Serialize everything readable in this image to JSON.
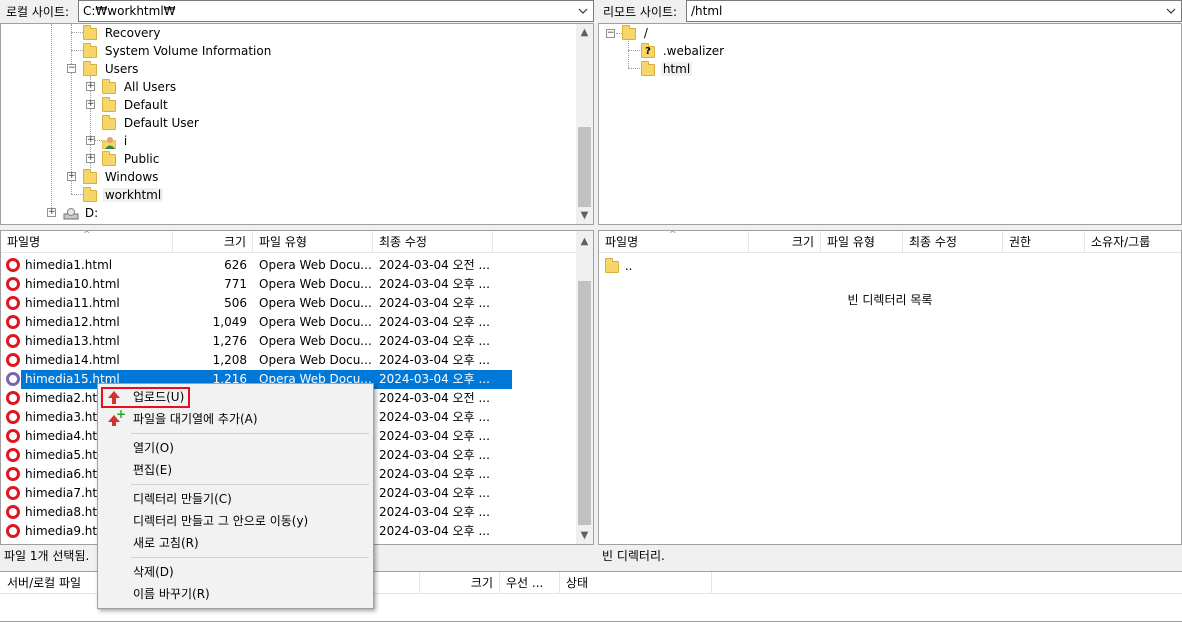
{
  "local_site": {
    "label": "로컬 사이트:",
    "path": "C:₩workhtml₩"
  },
  "remote_site": {
    "label": "리모트 사이트:",
    "path": "/html"
  },
  "local_tree": [
    {
      "label": "Recovery"
    },
    {
      "label": "System Volume Information"
    },
    {
      "label": "Users"
    },
    {
      "label": "All Users"
    },
    {
      "label": "Default"
    },
    {
      "label": "Default User"
    },
    {
      "label": "i"
    },
    {
      "label": "Public"
    },
    {
      "label": "Windows"
    },
    {
      "label": "workhtml"
    },
    {
      "label": "D:"
    }
  ],
  "remote_tree": [
    {
      "label": "/"
    },
    {
      "label": ".webalizer"
    },
    {
      "label": "html"
    }
  ],
  "local_list": {
    "columns": [
      "파일명",
      "크기",
      "파일 유형",
      "최종 수정"
    ],
    "rows": [
      {
        "name": "himedia1.html",
        "size": "626",
        "type": "Opera Web Docu...",
        "modified": "2024-03-04 오전 ..."
      },
      {
        "name": "himedia10.html",
        "size": "771",
        "type": "Opera Web Docu...",
        "modified": "2024-03-04 오후 ..."
      },
      {
        "name": "himedia11.html",
        "size": "506",
        "type": "Opera Web Docu...",
        "modified": "2024-03-04 오후 ..."
      },
      {
        "name": "himedia12.html",
        "size": "1,049",
        "type": "Opera Web Docu...",
        "modified": "2024-03-04 오후 ..."
      },
      {
        "name": "himedia13.html",
        "size": "1,276",
        "type": "Opera Web Docu...",
        "modified": "2024-03-04 오후 ..."
      },
      {
        "name": "himedia14.html",
        "size": "1,208",
        "type": "Opera Web Docu...",
        "modified": "2024-03-04 오후 ..."
      },
      {
        "name": "himedia15.html",
        "size": "1,216",
        "type": "Opera Web Docu...",
        "modified": "2024-03-04 오후 ..."
      },
      {
        "name": "himedia2.html",
        "size": "",
        "type": "",
        "modified": "2024-03-04 오전 ..."
      },
      {
        "name": "himedia3.html",
        "size": "",
        "type": "",
        "modified": "2024-03-04 오후 ..."
      },
      {
        "name": "himedia4.html",
        "size": "",
        "type": "",
        "modified": "2024-03-04 오후 ..."
      },
      {
        "name": "himedia5.html",
        "size": "",
        "type": "",
        "modified": "2024-03-04 오후 ..."
      },
      {
        "name": "himedia6.html",
        "size": "",
        "type": "",
        "modified": "2024-03-04 오후 ..."
      },
      {
        "name": "himedia7.html",
        "size": "",
        "type": "",
        "modified": "2024-03-04 오후 ..."
      },
      {
        "name": "himedia8.html",
        "size": "",
        "type": "",
        "modified": "2024-03-04 오후 ..."
      },
      {
        "name": "himedia9.html",
        "size": "",
        "type": "",
        "modified": "2024-03-04 오후 ..."
      }
    ]
  },
  "remote_list": {
    "columns": [
      "파일명",
      "크기",
      "파일 유형",
      "최종 수정",
      "권한",
      "소유자/그룹"
    ],
    "parent_dir": "..",
    "empty_message": "빈 디렉터리 목록"
  },
  "status": {
    "local": "파일 1개 선택됨.",
    "remote": "빈 디렉터리."
  },
  "queue": {
    "columns": [
      "서버/로컬 파일",
      "크기",
      "우선 ...",
      "상태"
    ]
  },
  "context_menu": {
    "items": [
      {
        "label": "업로드(U)"
      },
      {
        "label": "파일을 대기열에 추가(A)"
      },
      {
        "label": "열기(O)"
      },
      {
        "label": "편집(E)"
      },
      {
        "label": "디렉터리 만들기(C)"
      },
      {
        "label": "디렉터리 만들고 그 안으로 이동(y)"
      },
      {
        "label": "새로 고침(R)"
      },
      {
        "label": "삭제(D)"
      },
      {
        "label": "이름 바꾸기(R)"
      }
    ]
  },
  "colors": {
    "selection": "#0078d7",
    "highlight_border": "#e81020",
    "opera_red": "#e0161e"
  },
  "icons": [
    "folder-icon",
    "opera-file-icon",
    "upload-arrow-icon",
    "add-to-queue-icon",
    "user-folder-icon",
    "drive-icon",
    "question-folder-icon"
  ]
}
